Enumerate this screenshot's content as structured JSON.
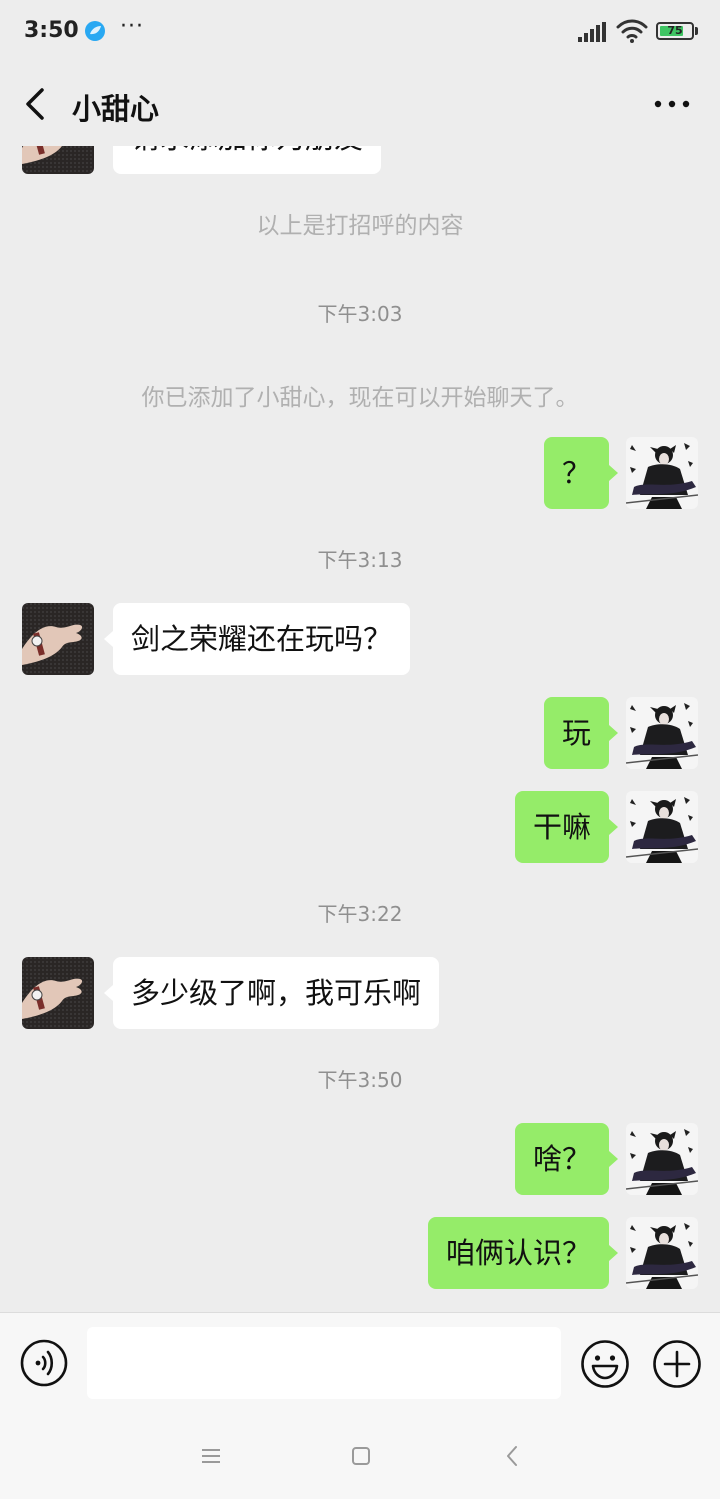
{
  "status_bar": {
    "time": "3:50",
    "app_icon": "blue-app-icon",
    "more": "···",
    "battery_level": "75",
    "battery_fraction": 0.75
  },
  "header": {
    "title": "小甜心",
    "back_icon": "back-arrow-icon",
    "menu_icon": "more-dots-icon"
  },
  "messages": {
    "top_partial": "请求添加你为朋友",
    "greeting_note": "以上是打招呼的内容",
    "time_1": "下午3:03",
    "added_note": "你已添加了小甜心，现在可以开始聊天了。",
    "m1": "？",
    "time_2": "下午3:13",
    "m2": "剑之荣耀还在玩吗？",
    "m3": "玩",
    "m4": "干嘛",
    "time_3": "下午3:22",
    "m5": "多少级了啊，我可乐啊",
    "time_4": "下午3:50",
    "m6": "啥？",
    "m7": "咱俩认识？"
  },
  "input_bar": {
    "value": "",
    "voice_icon": "voice-icon",
    "emoji_icon": "emoji-icon",
    "plus_icon": "plus-icon"
  },
  "colors": {
    "background": "#ededed",
    "self_bubble": "#95ec69",
    "other_bubble": "#ffffff",
    "system_text": "#b0b0b0"
  }
}
